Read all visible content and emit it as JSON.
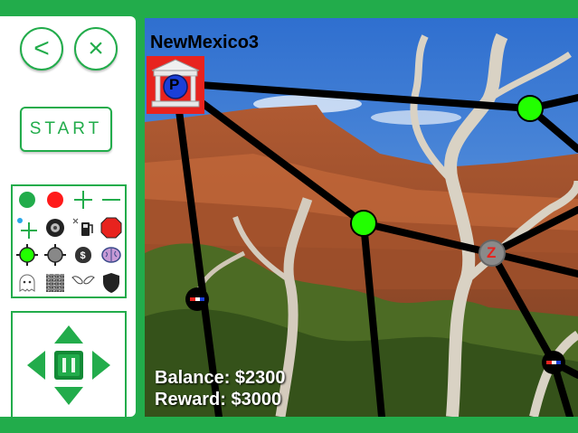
{
  "toolbar": {
    "back_icon": "<",
    "close_icon": "×",
    "start_label": "START"
  },
  "palette": {
    "items": [
      {
        "name": "green-node-icon"
      },
      {
        "name": "red-node-icon"
      },
      {
        "name": "plus-icon"
      },
      {
        "name": "minus-icon"
      },
      {
        "name": "add-connection-icon"
      },
      {
        "name": "tire-icon"
      },
      {
        "name": "fuel-pump-icon"
      },
      {
        "name": "stop-sign-icon"
      },
      {
        "name": "green-target-icon"
      },
      {
        "name": "gray-target-icon"
      },
      {
        "name": "money-bag-icon"
      },
      {
        "name": "brain-icon"
      },
      {
        "name": "ghost-icon"
      },
      {
        "name": "noise-icon"
      },
      {
        "name": "wings-icon"
      },
      {
        "name": "shield-icon"
      }
    ],
    "money_bag_glyph": "$"
  },
  "map": {
    "title": "NewMexico3",
    "bank_label": "P",
    "z_label": "Z",
    "balance_text": "Balance: $2300",
    "reward_text": "Reward: $3000"
  },
  "colors": {
    "frame": "#22ac4b",
    "node_green": "#22ff00",
    "node_gray": "#8a8a8a",
    "bank_bg": "#e8231e"
  }
}
